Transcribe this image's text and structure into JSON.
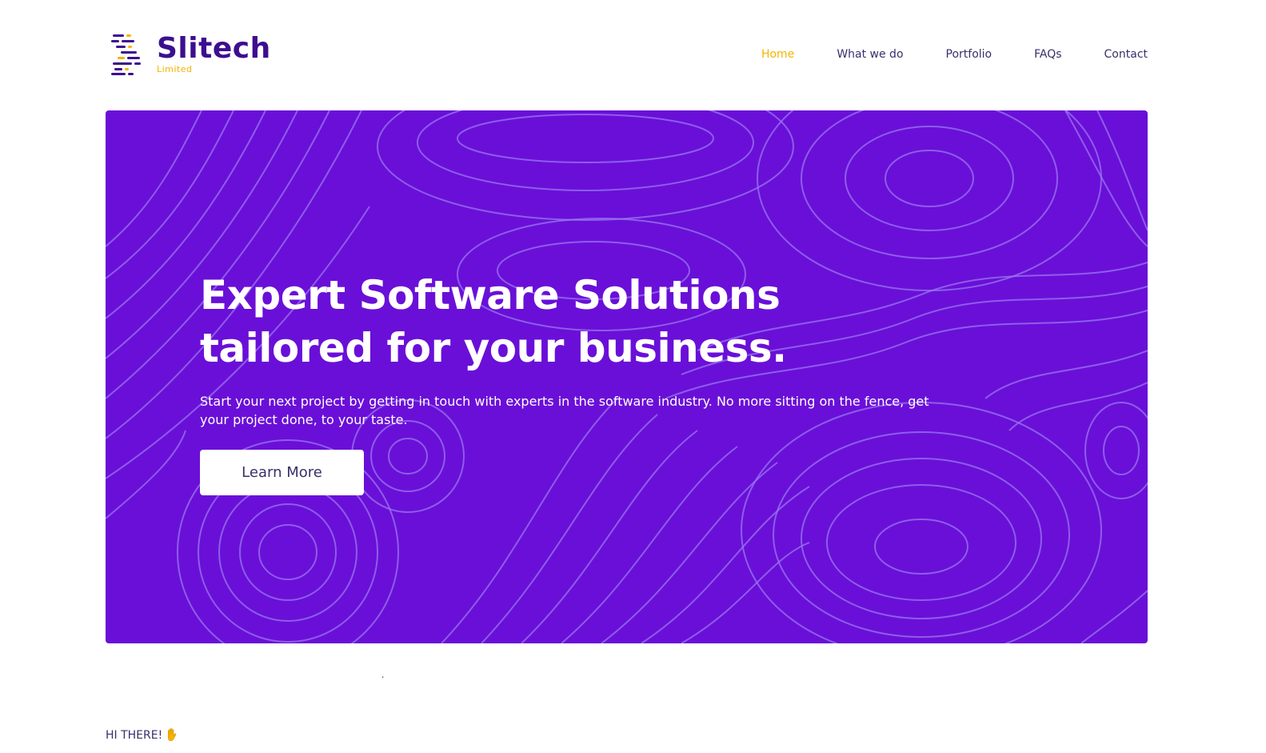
{
  "brand": {
    "name": "Slitech",
    "sub": "Limited",
    "colors": {
      "primary": "#3d0e8f",
      "accent": "#f4b400",
      "hero": "#6a0fd8"
    }
  },
  "nav": {
    "items": [
      {
        "label": "Home",
        "active": true
      },
      {
        "label": "What we do",
        "active": false
      },
      {
        "label": "Portfolio",
        "active": false
      },
      {
        "label": "FAQs",
        "active": false
      },
      {
        "label": "Contact",
        "active": false
      }
    ]
  },
  "hero": {
    "title": "Expert Software Solutions tailored for your business.",
    "subtitle": "Start your next project by getting in touch with experts in the software industry. No more sitting on the fence, get your project done, to your taste.",
    "button_label": "Learn More",
    "background": "topographic-contour-pattern"
  },
  "misc": {
    "mark": "⠐"
  },
  "greeting": {
    "text": "HI THERE!",
    "icon": "raised-hand-icon"
  }
}
